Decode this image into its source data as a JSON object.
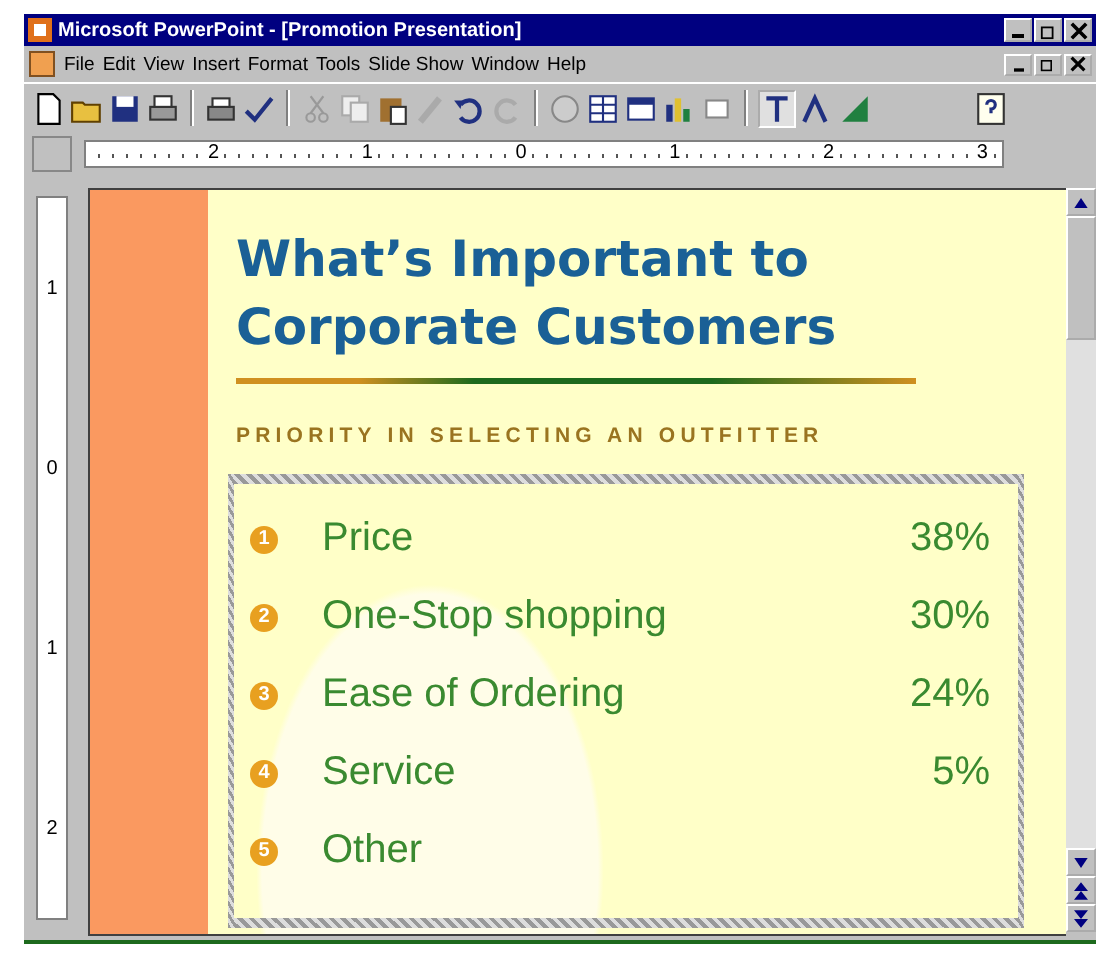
{
  "window": {
    "title": "Microsoft PowerPoint - [Promotion Presentation]"
  },
  "menu": [
    "File",
    "Edit",
    "View",
    "Insert",
    "Format",
    "Tools",
    "Slide Show",
    "Window",
    "Help"
  ],
  "ruler": {
    "horizontal": [
      "2",
      "1",
      "0",
      "1",
      "2",
      "3"
    ],
    "vertical": [
      "1",
      "0",
      "1",
      "2"
    ]
  },
  "slide": {
    "title": "What’s Important to Corporate Customers",
    "subtitle": "PRIORITY IN SELECTING AN OUTFITTER",
    "items": [
      {
        "number": "1",
        "label": "Price",
        "value": "38%"
      },
      {
        "number": "2",
        "label": "One-Stop shopping",
        "value": "30%"
      },
      {
        "number": "3",
        "label": "Ease of Ordering",
        "value": "24%"
      },
      {
        "number": "4",
        "label": "Service",
        "value": "5%"
      },
      {
        "number": "5",
        "label": "Other",
        "value": ""
      }
    ]
  }
}
